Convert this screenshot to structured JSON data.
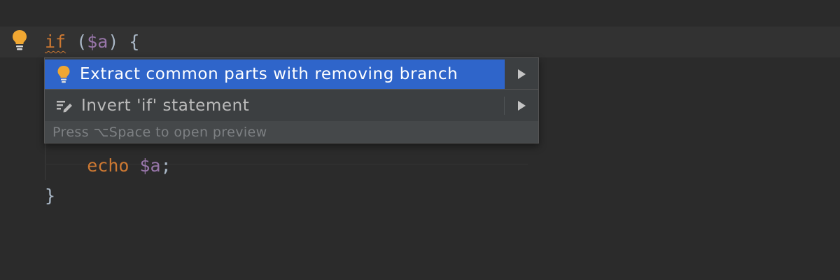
{
  "editor": {
    "line1": {
      "keyword": "if",
      "open_paren": " (",
      "variable": "$a",
      "close": ") {"
    },
    "line2": {
      "indent": "    ",
      "keyword": "echo",
      "space": " ",
      "variable": "$a",
      "end": ";"
    },
    "line3": {
      "text": "}"
    }
  },
  "popup": {
    "items": [
      {
        "label": "Extract common parts with removing branch",
        "icon": "lightbulb-icon",
        "selected": true
      },
      {
        "label": "Invert 'if' statement",
        "icon": "edit-icon",
        "selected": false
      }
    ],
    "footer": "Press ⌥Space to open preview"
  },
  "colors": {
    "background": "#2b2b2b",
    "keyword": "#cc7832",
    "variable": "#9876aa",
    "text": "#a9b7c6",
    "selection": "#2f65ca",
    "bulb": "#f0a732"
  }
}
